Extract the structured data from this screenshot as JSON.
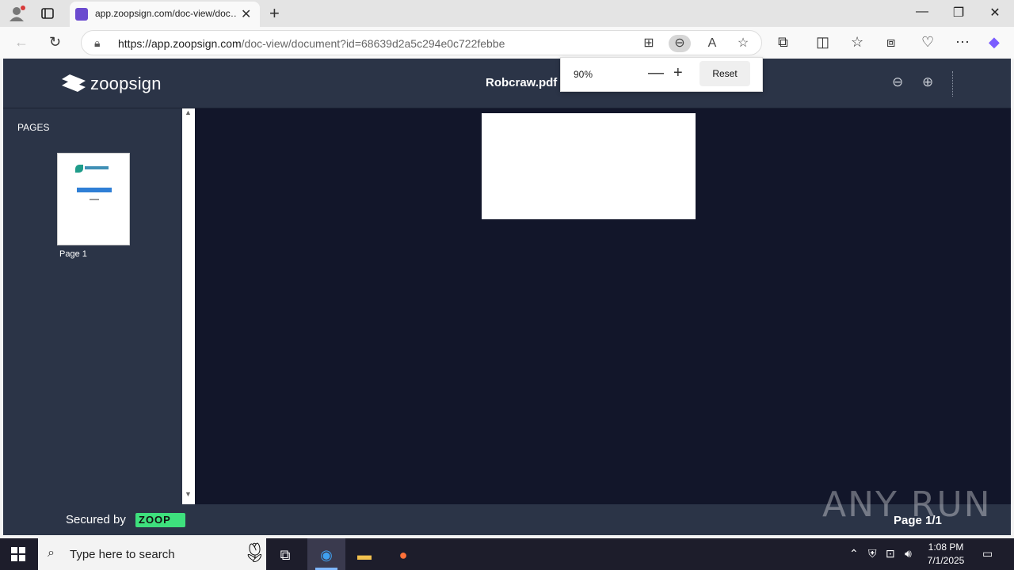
{
  "browser": {
    "tab_title": "app.zoopsign.com/doc-view/doc…",
    "url_host": "https://app.zoopsign.com",
    "url_path": "/doc-view/document?id=68639d2a5c294e0c722febbe"
  },
  "zoom_popup": {
    "value": "90%",
    "reset_label": "Reset"
  },
  "app": {
    "brand": "zoopsign",
    "filename": "Robcraw.pdf",
    "pages_label": "PAGES",
    "thumb_label": "Page 1",
    "secured_label": "Secured by",
    "secured_brand": "ZOOP",
    "page_count": "Page 1/1"
  },
  "watermark": "ANY RUN",
  "taskbar": {
    "search_placeholder": "Type here to search",
    "time": "1:08 PM",
    "date": "7/1/2025"
  },
  "colors": {
    "app_header": "#2b3447",
    "viewer_bg": "#12162a",
    "zoop_green": "#3ee07d"
  }
}
